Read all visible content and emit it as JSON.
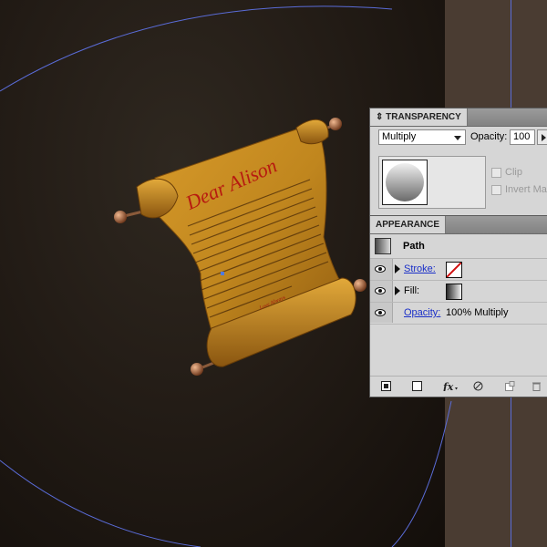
{
  "scroll": {
    "title": "Dear Alison",
    "signature": "Love Always"
  },
  "transparency": {
    "tab_label": "TRANSPARENCY",
    "blend_mode": "Multiply",
    "opacity_label": "Opacity:",
    "opacity_value": "100",
    "clip_label": "Clip",
    "invert_mask_label": "Invert Mas"
  },
  "appearance": {
    "tab_label": "APPEARANCE",
    "path_label": "Path",
    "stroke_label": "Stroke:",
    "fill_label": "Fill:",
    "opacity_label": "Opacity:",
    "opacity_value": "100% Multiply"
  },
  "colors": {
    "guide": "#5a6cd8",
    "parchment": "#c68a22",
    "ink": "#b71a10"
  }
}
